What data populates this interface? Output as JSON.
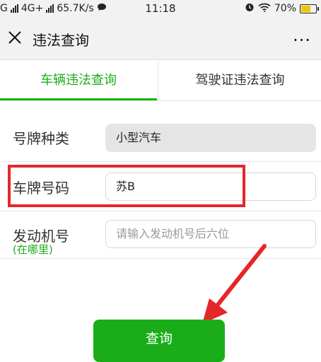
{
  "status_bar": {
    "carrier_left": "G",
    "network": "4G+",
    "speed": "65.7K/s",
    "time": "11:18",
    "battery_text": "70%",
    "battery_level": 0.7
  },
  "title_bar": {
    "title": "违法查询",
    "more_label": "..."
  },
  "tabs": [
    {
      "label": "车辆违法查询",
      "active": true
    },
    {
      "label": "驾驶证违法查询",
      "active": false
    }
  ],
  "form": {
    "plate_type": {
      "label": "号牌种类",
      "value": "小型汽车"
    },
    "plate_number": {
      "label": "车牌号码",
      "value": "苏B"
    },
    "engine_number": {
      "label": "发动机号",
      "help": "(在哪里)",
      "placeholder": "请输入发动机号后六位"
    }
  },
  "submit_label": "查询",
  "colors": {
    "accent": "#1aad19",
    "annotation": "#e4262b"
  }
}
